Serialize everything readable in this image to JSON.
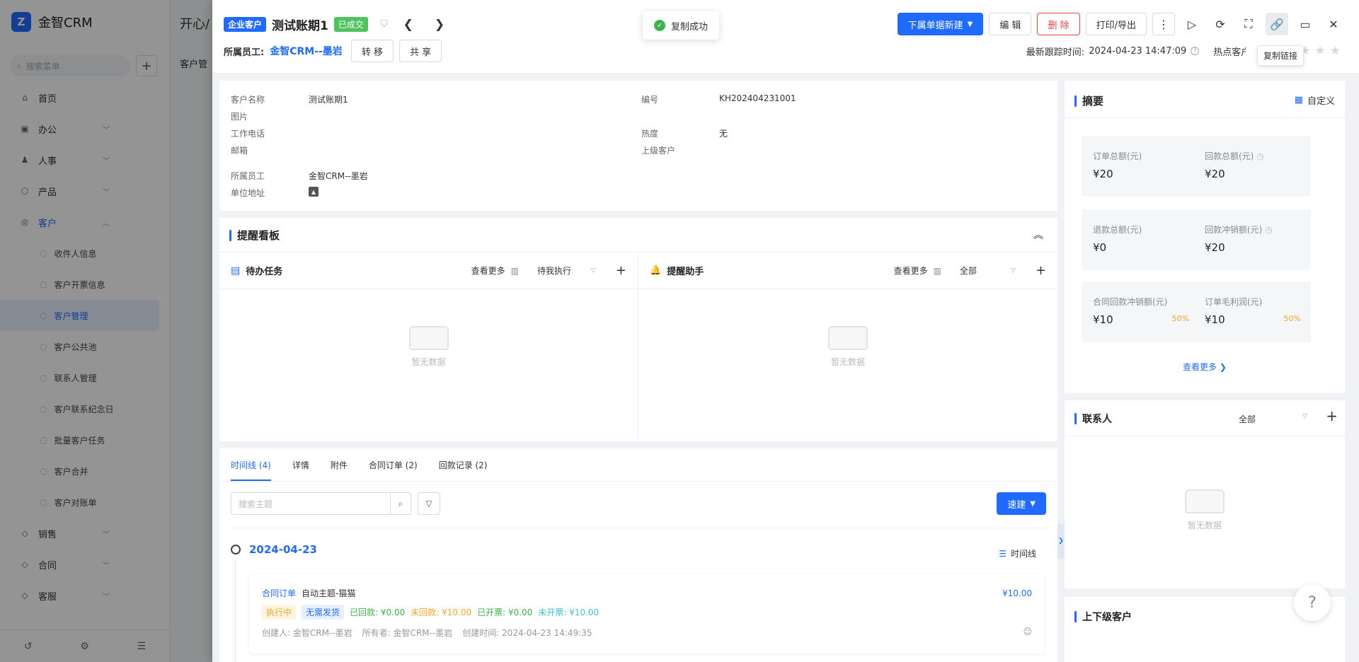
{
  "app": {
    "brand": "金智CRM",
    "search_placeholder": "搜索菜单",
    "menu": [
      {
        "label": "首页",
        "icon": "home-icon"
      },
      {
        "label": "办公",
        "icon": "office-icon",
        "expandable": true
      },
      {
        "label": "人事",
        "icon": "people-icon",
        "expandable": true
      },
      {
        "label": "产品",
        "icon": "product-icon",
        "expandable": true
      },
      {
        "label": "客户",
        "icon": "customer-icon",
        "expandable": true,
        "expanded": true
      }
    ],
    "submenu": [
      {
        "label": "收件人信息"
      },
      {
        "label": "客户开票信息"
      },
      {
        "label": "客户管理",
        "active": true
      },
      {
        "label": "客户公共池"
      },
      {
        "label": "联系人管理"
      },
      {
        "label": "客户联系纪念日"
      },
      {
        "label": "批量客户任务"
      },
      {
        "label": "客户合并"
      },
      {
        "label": "客户对账单"
      }
    ],
    "menu_after": [
      {
        "label": "销售"
      },
      {
        "label": "合同"
      },
      {
        "label": "客服"
      }
    ],
    "bg_breadcrumb": "开心/",
    "bg_tab": "客户管"
  },
  "toast": {
    "text": "复制成功"
  },
  "header": {
    "type_tag": "企业客户",
    "title": "测试账期1",
    "status_tag": "已成交",
    "owner_label": "所属员工:",
    "owner_value": "金智CRM--墨岩",
    "transfer": "转 移",
    "share": "共 享",
    "new_btn": "下属单据新建",
    "edit": "编 辑",
    "delete": "删 除",
    "print": "打印/导出",
    "last_follow_label": "最新跟踪时间:",
    "last_follow_value": "2024-04-23 14:47:09",
    "hot_label": "热点客户",
    "tooltip": "复制链接"
  },
  "info": {
    "fields_left": [
      {
        "k": "客户名称",
        "v": "测试账期1"
      },
      {
        "k": "图片",
        "v": ""
      },
      {
        "k": "工作电话",
        "v": ""
      },
      {
        "k": "邮箱",
        "v": ""
      },
      {
        "k": "所属员工",
        "v": "金智CRM--墨岩"
      },
      {
        "k": "单位地址",
        "v": ""
      }
    ],
    "fields_right": [
      {
        "k": "编号",
        "v": "KH202404231001"
      },
      {
        "k": "热度",
        "v": "无"
      },
      {
        "k": "上级客户",
        "v": ""
      }
    ]
  },
  "board": {
    "title": "提醒看板",
    "todo": {
      "title": "待办任务",
      "more": "查看更多",
      "filter": "待我执行",
      "empty": "暂无数据"
    },
    "remind": {
      "title": "提醒助手",
      "more": "查看更多",
      "filter": "全部",
      "empty": "暂无数据"
    }
  },
  "timeline": {
    "tabs": [
      "时间线 (4)",
      "详情",
      "附件",
      "合同订单 (2)",
      "回款记录 (2)"
    ],
    "search_placeholder": "搜索主题",
    "quick": "速建",
    "date": "2024-04-23",
    "switch_label": "时间线",
    "item": {
      "type": "合同订单",
      "subject": "自动主题-猫猫",
      "amount": "¥10.00",
      "status": "执行中",
      "ship": "无需发货",
      "paid": "已回款: ¥0.00",
      "unpaid": "未回款: ¥10.00",
      "invoiced": "已开票: ¥0.00",
      "uninvoiced": "未开票: ¥10.00",
      "creator": "创建人: 金智CRM--墨岩",
      "owner": "所有者: 金智CRM--墨岩",
      "created": "创建时间: 2024-04-23 14:49:35"
    }
  },
  "summary": {
    "title": "摘要",
    "customize": "自定义",
    "metrics": [
      {
        "label": "订单总额(元)",
        "value": "¥20",
        "pct": ""
      },
      {
        "label": "回款总额(元)",
        "value": "¥20",
        "pct": "",
        "info": true
      },
      {
        "label": "退款总额(元)",
        "value": "¥0",
        "pct": ""
      },
      {
        "label": "回款冲销额(元)",
        "value": "¥20",
        "pct": "",
        "info": true
      },
      {
        "label": "合同回款冲销额(元)",
        "value": "¥10",
        "pct": "50%"
      },
      {
        "label": "订单毛利润(元)",
        "value": "¥10",
        "pct": "50%"
      }
    ],
    "more": "查看更多"
  },
  "contacts": {
    "title": "联系人",
    "filter": "全部",
    "empty": "暂无数据"
  },
  "parents": {
    "title": "上下级客户"
  },
  "colors": {
    "primary": "#1f6bff",
    "success": "#4cc35e",
    "danger": "#e54545",
    "warning": "#f5a623"
  }
}
